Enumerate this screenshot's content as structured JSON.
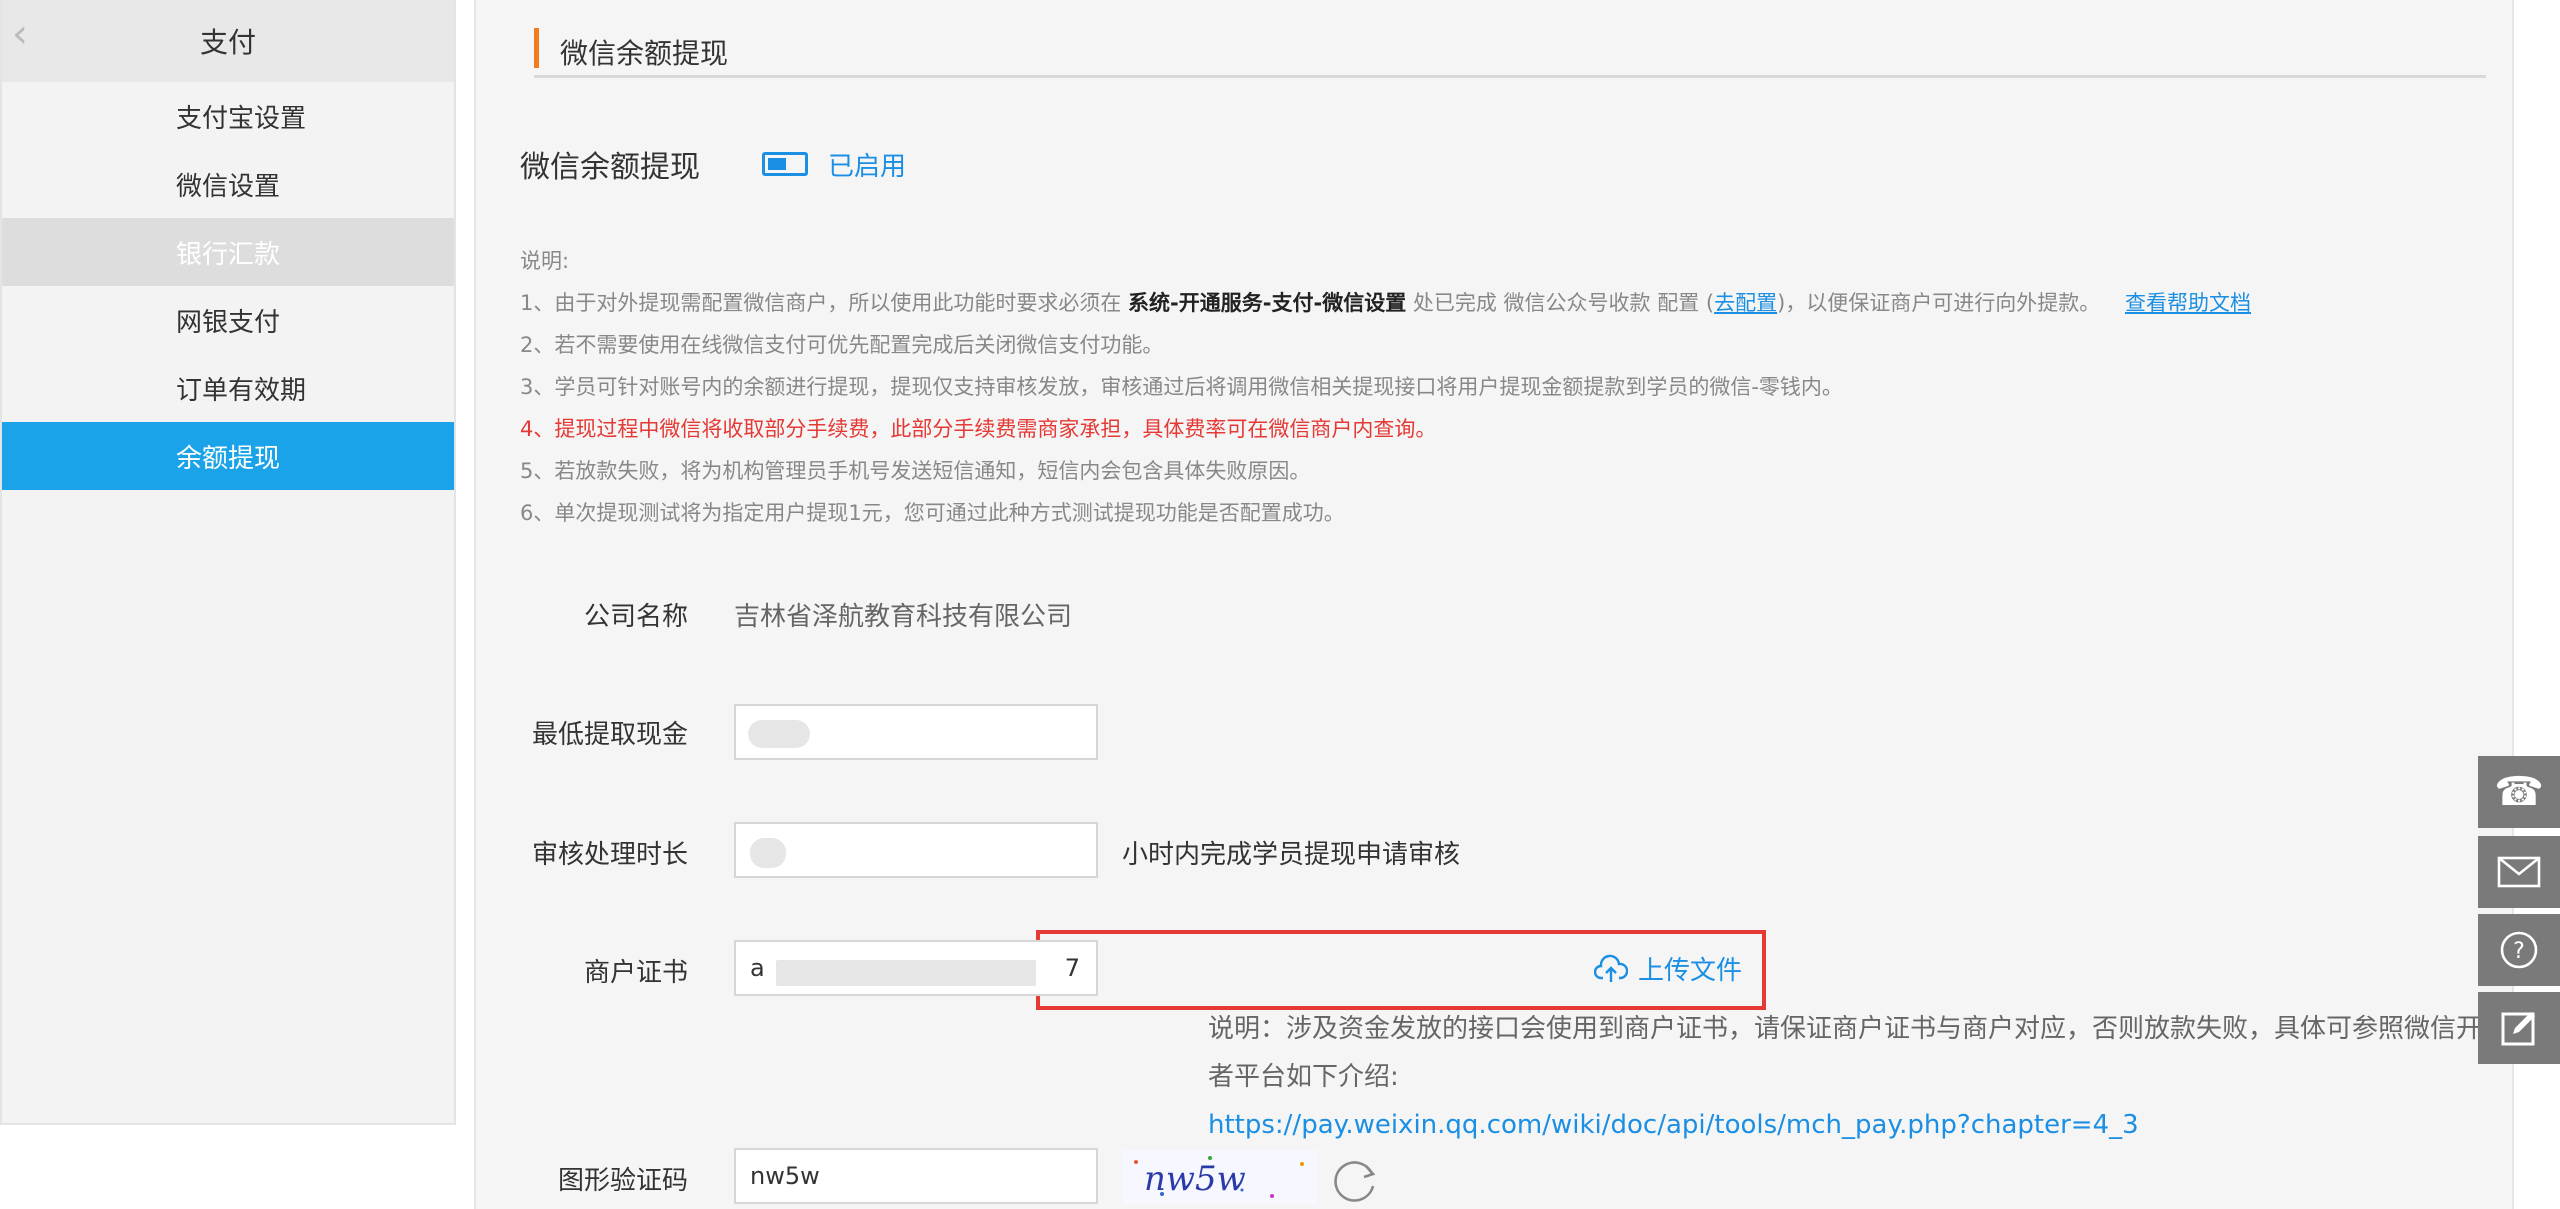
{
  "sidebar": {
    "title": "支付",
    "items": [
      {
        "label": "支付宝设置"
      },
      {
        "label": "微信设置"
      },
      {
        "label": "银行汇款"
      },
      {
        "label": "网银支付"
      },
      {
        "label": "订单有效期"
      },
      {
        "label": "余额提现"
      }
    ]
  },
  "main": {
    "section_title": "微信余额提现",
    "toggle": {
      "label": "微信余额提现",
      "state": "已启用",
      "enabled": true
    },
    "notes": {
      "head": "说明:",
      "line1_pre": "1、由于对外提现需配置微信商户，所以使用此功能时要求必须在 ",
      "line1_bold": "系统-开通服务-支付-微信设置",
      "line1_mid": " 处已完成 微信公众号收款 配置 (",
      "line1_link": "去配置",
      "line1_post": ")，以便保证商户可进行向外提款。",
      "help_link": "查看帮助文档",
      "line2": "2、若不需要使用在线微信支付可优先配置完成后关闭微信支付功能。",
      "line3": "3、学员可针对账号内的余额进行提现，提现仅支持审核发放，审核通过后将调用微信相关提现接口将用户提现金额提款到学员的微信-零钱内。",
      "line4": "4、提现过程中微信将收取部分手续费，此部分手续费需商家承担，具体费率可在微信商户内查询。",
      "line5": "5、若放款失败，将为机构管理员手机号发送短信通知，短信内会包含具体失败原因。",
      "line6": "6、单次提现测试将为指定用户提现1元，您可通过此种方式测试提现功能是否配置成功。"
    },
    "form": {
      "company_label": "公司名称",
      "company_value": "吉林省泽航教育科技有限公司",
      "min_cash_label": "最低提取现金",
      "review_label": "审核处理时长",
      "review_suffix": "小时内完成学员提现申请审核",
      "cert_label": "商户证书",
      "cert_value_start": "a",
      "cert_value_end": "7",
      "upload_label": "上传文件",
      "cert_desc": "说明：涉及资金发放的接口会使用到商户证书，请保证商户证书与商户对应，否则放款失败，具体可参照微信开发者平台如下介绍:",
      "cert_link": "https://pay.weixin.qq.com/wiki/doc/api/tools/mch_pay.php?chapter=4_3",
      "captcha_label": "图形验证码",
      "captcha_value": "nw5w",
      "captcha_image_text": "nw5w"
    }
  },
  "float_tools": [
    {
      "icon": "phone-icon"
    },
    {
      "icon": "mail-icon"
    },
    {
      "icon": "help-icon"
    },
    {
      "icon": "edit-icon"
    }
  ],
  "colors": {
    "accent": "#1aa3e8",
    "link": "#1a8fe3",
    "warning": "#e53935",
    "title_bar": "#f07c1f"
  }
}
